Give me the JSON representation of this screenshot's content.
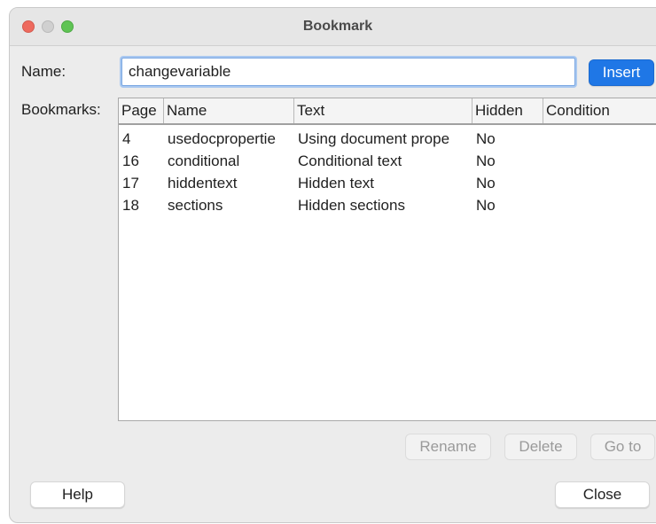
{
  "window": {
    "title": "Bookmark"
  },
  "name_field": {
    "label": "Name:",
    "value": "changevariable"
  },
  "buttons": {
    "insert": "Insert",
    "rename": "Rename",
    "delete": "Delete",
    "goto": "Go to",
    "help": "Help",
    "close": "Close"
  },
  "bookmarks": {
    "label": "Bookmarks:",
    "columns": [
      "Page",
      "Name",
      "Text",
      "Hidden",
      "Condition"
    ],
    "rows": [
      {
        "page": "4",
        "name": "usedocpropertie",
        "text": "Using document prope",
        "hidden": "No",
        "condition": ""
      },
      {
        "page": "16",
        "name": "conditional",
        "text": "Conditional text",
        "hidden": "No",
        "condition": ""
      },
      {
        "page": "17",
        "name": "hiddentext",
        "text": "Hidden text",
        "hidden": "No",
        "condition": ""
      },
      {
        "page": "18",
        "name": "sections",
        "text": "Hidden sections",
        "hidden": "No",
        "condition": ""
      }
    ]
  },
  "colors": {
    "accent": "#1f77e6",
    "close_traffic": "#ee6a5e",
    "zoom_traffic": "#5fc454"
  },
  "icons": [
    "close-window-icon",
    "minimize-window-icon",
    "zoom-window-icon"
  ]
}
